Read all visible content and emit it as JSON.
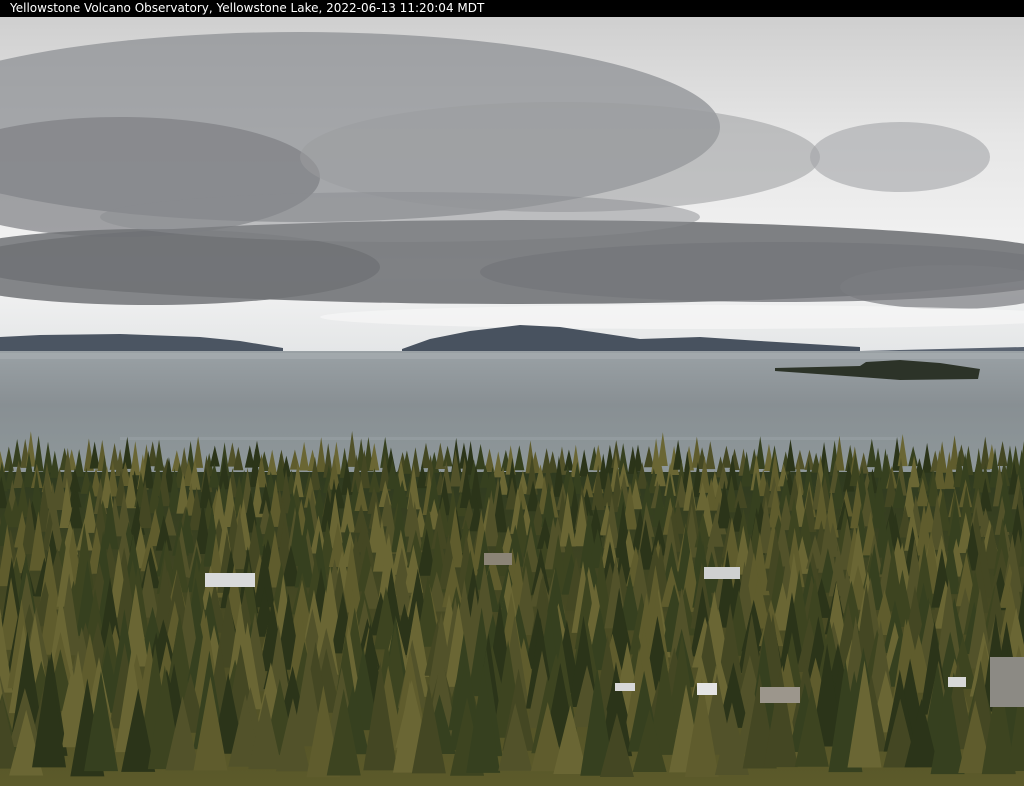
{
  "caption": {
    "text": "Yellowstone Volcano Observatory, Yellowstone Lake, 2022-06-13 11:20:04 MDT"
  },
  "scene": {
    "subjects": [
      "overcast-sky",
      "lake",
      "distant-mountains",
      "island",
      "conifer-forest",
      "cabins"
    ],
    "colors": {
      "sky_light": "#e8e8e8",
      "cloud_dark": "#6d6f73",
      "lake": "#8a9296",
      "mountain": "#4a5461",
      "forest": "#3b3f1f",
      "forest_light": "#6b6a33"
    }
  }
}
